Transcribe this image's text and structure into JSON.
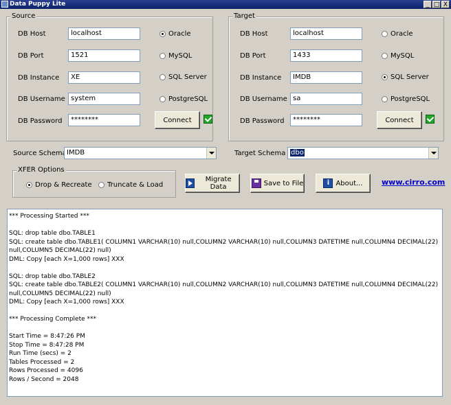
{
  "window": {
    "title": "Data Puppy Lite",
    "min_glyph": "_",
    "max_glyph": "□",
    "close_glyph": "X"
  },
  "source": {
    "title": "Source",
    "host_label": "DB Host",
    "host_value": "localhost",
    "port_label": "DB Port",
    "port_value": "1521",
    "instance_label": "DB Instance",
    "instance_value": "XE",
    "username_label": "DB Username",
    "username_value": "system",
    "password_label": "DB Password",
    "password_value": "********",
    "db_types": [
      {
        "label": "Oracle",
        "selected": true
      },
      {
        "label": "MySQL",
        "selected": false
      },
      {
        "label": "SQL Server",
        "selected": false
      },
      {
        "label": "PostgreSQL",
        "selected": false
      }
    ],
    "connect_label": "Connect",
    "connected": true
  },
  "target": {
    "title": "Target",
    "host_label": "DB Host",
    "host_value": "localhost",
    "port_label": "DB Port",
    "port_value": "1433",
    "instance_label": "DB Instance",
    "instance_value": "IMDB",
    "username_label": "DB Username",
    "username_value": "sa",
    "password_label": "DB Password",
    "password_value": "********",
    "db_types": [
      {
        "label": "Oracle",
        "selected": false
      },
      {
        "label": "MySQL",
        "selected": false
      },
      {
        "label": "SQL Server",
        "selected": true
      },
      {
        "label": "PostgreSQL",
        "selected": false
      }
    ],
    "connect_label": "Connect",
    "connected": true
  },
  "schemas": {
    "source_label": "Source Schema",
    "source_value": "IMDB",
    "target_label": "Target Schema",
    "target_value": "dbo"
  },
  "xfer": {
    "title": "XFER Options",
    "options": [
      {
        "label": "Drop & Recreate",
        "selected": true
      },
      {
        "label": "Truncate & Load",
        "selected": false
      }
    ]
  },
  "actions": {
    "migrate_label": "Migrate Data",
    "save_label": "Save to File",
    "about_label": "About...",
    "link_text": "www.cirro.com"
  },
  "log": [
    "*** Processing Started ***",
    "",
    "SQL: drop table dbo.TABLE1",
    "SQL: create table dbo.TABLE1( COLUMN1 VARCHAR(10) null,COLUMN2 VARCHAR(10) null,COLUMN3 DATETIME null,COLUMN4 DECIMAL(22) null,COLUMN5 DECIMAL(22) null)",
    "DML: Copy [each X=1,000 rows] XXX",
    "",
    "SQL: drop table dbo.TABLE2",
    "SQL: create table dbo.TABLE2( COLUMN1 VARCHAR(10) null,COLUMN2 VARCHAR(10) null,COLUMN3 DATETIME null,COLUMN4 DECIMAL(22) null,COLUMN5 DECIMAL(22) null)",
    "DML: Copy [each X=1,000 rows] XXX",
    "",
    "*** Processing Complete ***",
    "",
    "Start Time = 8:47:26 PM",
    "Stop Time = 8:47:28 PM",
    "Run Time (secs) = 2",
    "Tables Processed = 2",
    "Rows Processed = 4096",
    "Rows / Second = 2048"
  ]
}
